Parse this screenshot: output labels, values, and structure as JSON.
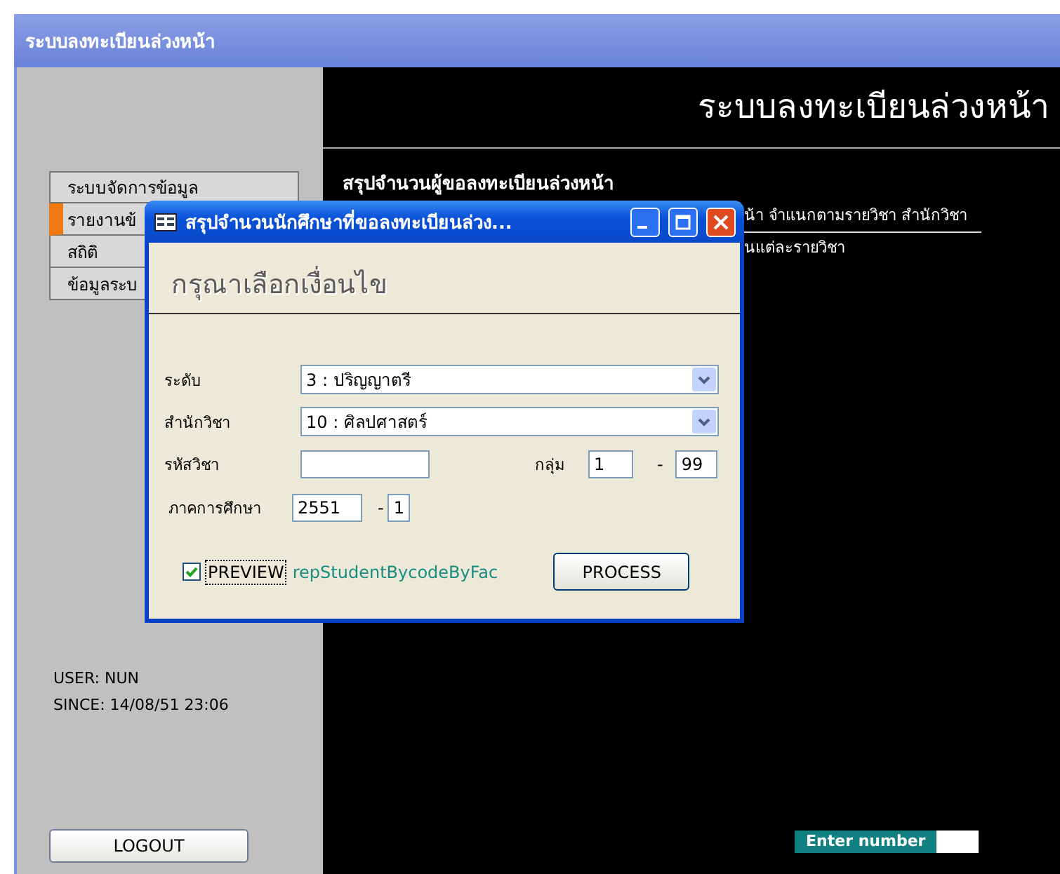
{
  "window": {
    "title": "ระบบลงทะเบียนล่วงหน้า"
  },
  "sidebar": {
    "items": [
      {
        "label": "ระบบจัดการข้อมูล",
        "selected": false
      },
      {
        "label": "รายงานข้",
        "selected": true
      },
      {
        "label": "สถิติ",
        "selected": false
      },
      {
        "label": "ข้อมูลระบ",
        "selected": false
      }
    ],
    "user": "USER: NUN",
    "since": "SINCE: 14/08/51 23:06",
    "logout_button": "LOGOUT"
  },
  "content": {
    "heading": "ระบบลงทะเบียนล่วงหน้า",
    "section_title": "สรุปจำนวนผู้ขอลงทะเบียนล่วงหน้า",
    "report_links": [
      "น้า จำแนกตามรายวิชา สำนักวิชา",
      "นแต่ละรายวิชา"
    ],
    "enter_number": {
      "label": "Enter number"
    }
  },
  "dialog": {
    "title": "สรุปจำนวนนักศึกษาที่ขอลงทะเบียนล่วง...",
    "heading": "กรุณาเลือกเงื่อนไข",
    "education_level": {
      "label": "ระดับ",
      "value": "3 : ปริญญาตรี"
    },
    "faculty": {
      "label": "สำนักวิชา",
      "value": "10 : ศิลปศาสตร์"
    },
    "course_code": {
      "label": "รหัสวิชา"
    },
    "group": {
      "label": "กลุ่ม",
      "from": "1",
      "separator": "-",
      "to": "99"
    },
    "semester": {
      "label": "ภาคการศึกษา",
      "year": "2551",
      "separator": "-",
      "term": "1"
    },
    "preview": {
      "label": "PREVIEW",
      "checked": true
    },
    "report_name": "repStudentBycodeByFac",
    "process_button": "PROCESS"
  }
}
